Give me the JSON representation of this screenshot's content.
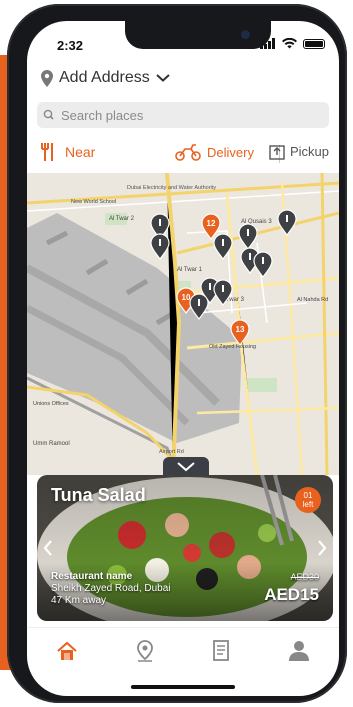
{
  "status_bar": {
    "time": "2:32"
  },
  "address": {
    "label": "Add Address"
  },
  "search": {
    "placeholder": "Search places"
  },
  "filters": {
    "near_label": "Near",
    "delivery_label": "Delivery",
    "pickup_label": "Pickup"
  },
  "map": {
    "markers": [
      {
        "kind": "gray"
      },
      {
        "kind": "orange",
        "label": "12"
      },
      {
        "kind": "gray"
      },
      {
        "kind": "gray"
      },
      {
        "kind": "gray"
      },
      {
        "kind": "gray"
      },
      {
        "kind": "gray"
      },
      {
        "kind": "gray"
      },
      {
        "kind": "gray"
      },
      {
        "kind": "orange",
        "label": "10"
      },
      {
        "kind": "gray"
      },
      {
        "kind": "gray"
      },
      {
        "kind": "orange",
        "label": "13"
      }
    ],
    "labels": {
      "l1": "Dubai Electricity and Water Authority",
      "l2": "Al Twar 2",
      "l3": "Al Twar 1",
      "l4": "Al Twar 3",
      "l5": "Al Qusais 3",
      "l6": "Old Zayed Housing",
      "l7": "Al Nahda Rd",
      "l8": "Umm Ramool",
      "l9": "New World School",
      "l10": "Airport Rd",
      "l11": "Unions Offices"
    }
  },
  "card": {
    "title": "Tuna Salad",
    "badge_count": "01",
    "badge_suffix": "left",
    "restaurant_name": "Restaurant name",
    "location": "Sheikh Zayed Road, Dubai",
    "distance": "47 Km away",
    "old_price": "AED30",
    "price": "AED15"
  },
  "colors": {
    "accent": "#e8611f",
    "marker_gray": "#3f4044"
  },
  "tabbar": {
    "icons": [
      "home-icon",
      "location-pin-icon",
      "orders-icon",
      "profile-icon"
    ]
  }
}
